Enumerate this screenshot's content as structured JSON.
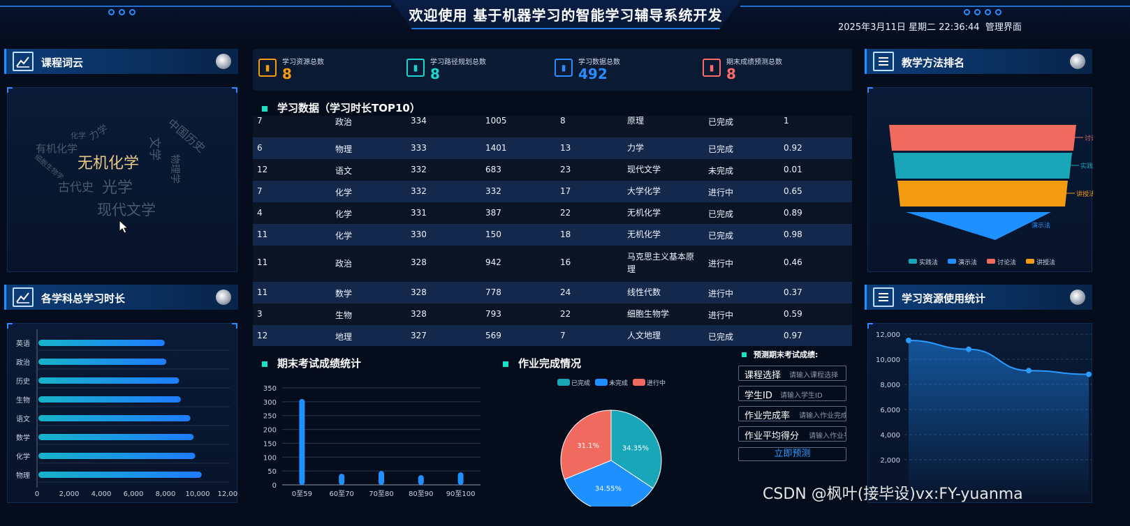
{
  "header": {
    "title": "欢迎使用 基于机器学习的智能学习辅导系统开发",
    "datetime": "2025年3月11日 星期二 22:36:44",
    "admin_link": "管理界面"
  },
  "left": {
    "wordcloud": {
      "title": "课程词云",
      "words": [
        "无机化学",
        "有机化学",
        "古代史",
        "光学",
        "现代文学",
        "中国历史",
        "文学",
        "力学",
        "物理学",
        "化学",
        "细胞生物学"
      ]
    },
    "hours": {
      "title": "各学科总学习时长",
      "chart_data": {
        "type": "bar",
        "orientation": "horizontal",
        "categories": [
          "英语",
          "政治",
          "历史",
          "生物",
          "语文",
          "数学",
          "化学",
          "物理"
        ],
        "values": [
          8300,
          8400,
          9200,
          9300,
          9900,
          10100,
          10200,
          10600
        ],
        "xlim": [
          0,
          12000
        ],
        "xticks": [
          "0",
          "2,000",
          "4,000",
          "6,000",
          "8,000",
          "10,000",
          "12,000"
        ]
      }
    }
  },
  "stats": [
    {
      "label": "学习资源总数",
      "value": "8",
      "color": "#f39c12",
      "icon": "book-icon"
    },
    {
      "label": "学习路径规划总数",
      "value": "8",
      "color": "#19d6d0",
      "icon": "people-icon"
    },
    {
      "label": "学习数据总数",
      "value": "492",
      "color": "#2a8cff",
      "icon": "data-icon"
    },
    {
      "label": "期末成绩预测总数",
      "value": "8",
      "color": "#ff6b6b",
      "icon": "predict-icon"
    }
  ],
  "table": {
    "title": "学习数据（学习时长TOP10）",
    "rows": [
      [
        "7",
        "政治",
        "334",
        "1005",
        "8",
        "原理",
        "已完成",
        "1"
      ],
      [
        "6",
        "物理",
        "333",
        "1401",
        "13",
        "力学",
        "已完成",
        "0.92"
      ],
      [
        "12",
        "语文",
        "332",
        "683",
        "23",
        "现代文学",
        "未完成",
        "0.01"
      ],
      [
        "7",
        "化学",
        "332",
        "332",
        "17",
        "大学化学",
        "进行中",
        "0.65"
      ],
      [
        "4",
        "化学",
        "331",
        "387",
        "22",
        "无机化学",
        "已完成",
        "0.89"
      ],
      [
        "11",
        "化学",
        "330",
        "150",
        "18",
        "无机化学",
        "已完成",
        "0.98"
      ],
      [
        "11",
        "政治",
        "328",
        "942",
        "16",
        "马克思主义基本原理",
        "进行中",
        "0.46"
      ],
      [
        "11",
        "数学",
        "328",
        "778",
        "24",
        "线性代数",
        "进行中",
        "0.37"
      ],
      [
        "3",
        "生物",
        "328",
        "793",
        "22",
        "细胞生物学",
        "进行中",
        "0.59"
      ],
      [
        "12",
        "地理",
        "327",
        "569",
        "7",
        "人文地理",
        "已完成",
        "0.97"
      ]
    ]
  },
  "exam": {
    "title": "期末考试成绩统计",
    "chart_data": {
      "type": "bar",
      "categories": [
        "0至59",
        "60至70",
        "70至80",
        "80至90",
        "90至100"
      ],
      "values": [
        310,
        40,
        50,
        35,
        45
      ],
      "ylim": [
        0,
        350
      ],
      "yticks": [
        "0",
        "50",
        "100",
        "150",
        "200",
        "250",
        "300",
        "350"
      ]
    }
  },
  "homework": {
    "title": "作业完成情况",
    "chart_data": {
      "type": "pie",
      "labels": [
        "已完成",
        "未完成",
        "进行中"
      ],
      "values": [
        34.35,
        34.55,
        31.1
      ],
      "value_labels": [
        "34.35%",
        "34.55%",
        "31.1%"
      ],
      "colors": [
        "#18a6b8",
        "#1e90ff",
        "#f06a60"
      ]
    }
  },
  "predict": {
    "title": "预测期末考试成绩:",
    "fields": [
      {
        "label": "课程选择",
        "placeholder": "请输入课程选择"
      },
      {
        "label": "学生ID",
        "placeholder": "请输入学生ID"
      },
      {
        "label": "作业完成率",
        "placeholder": "请输入作业完成率"
      },
      {
        "label": "作业平均得分",
        "placeholder": "请输入作业平均得分"
      }
    ],
    "button": "立即预测"
  },
  "right": {
    "methods": {
      "title": "教学方法排名",
      "chart_data": {
        "type": "funnel",
        "labels": [
          "讨论法",
          "实践法",
          "讲授法",
          "演示法"
        ],
        "colors": [
          "#f06a60",
          "#18a6b8",
          "#f39c12",
          "#1e90ff"
        ],
        "legend": [
          "实践法",
          "演示法",
          "讨论法",
          "讲授法"
        ]
      }
    },
    "resources": {
      "title": "学习资源使用统计",
      "chart_data": {
        "type": "area",
        "values": [
          11500,
          10800,
          9100,
          8800
        ],
        "ylim": [
          2000,
          12000
        ],
        "yticks": [
          "2,000",
          "4,000",
          "6,000",
          "8,000",
          "10,000",
          "12,000"
        ]
      }
    }
  },
  "watermark": "CSDN @枫叶(接毕设)vx:FY-yuanma"
}
